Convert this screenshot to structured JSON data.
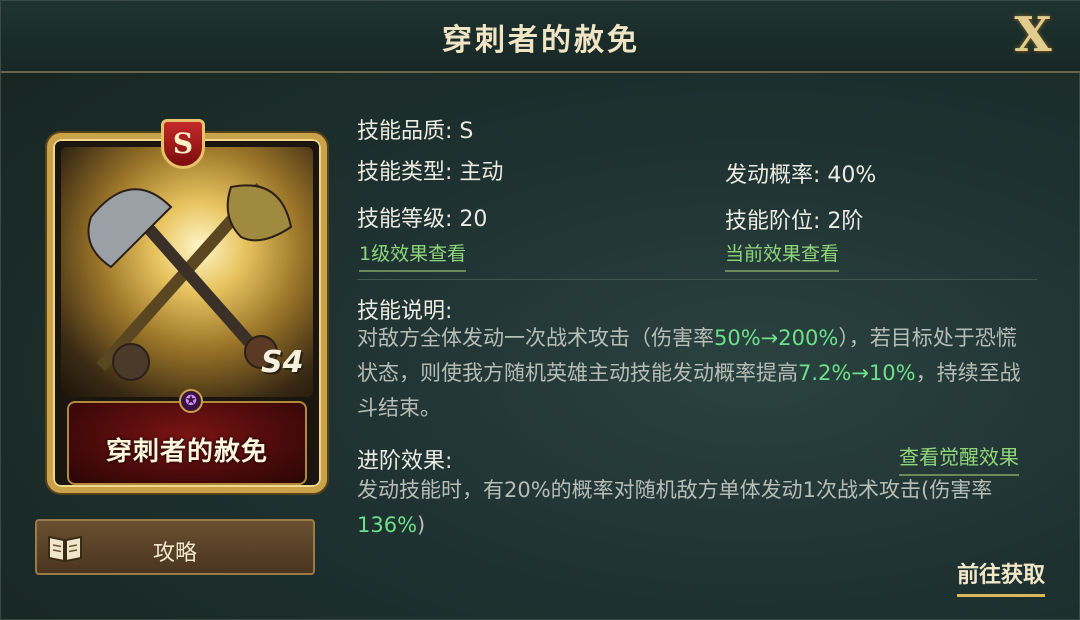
{
  "header": {
    "title": "穿刺者的赦免",
    "close_label": "X"
  },
  "card": {
    "grade_badge": "S",
    "name": "穿刺者的赦免",
    "level_mark": "S4",
    "emblem_icon": "faction-emblem-icon"
  },
  "guide_button": {
    "label": "攻略",
    "icon": "book-icon"
  },
  "stats": {
    "quality": "技能品质: S",
    "type": "技能类型: 主动",
    "chance": "发动概率: 40%",
    "level": "技能等级: 20",
    "rank": "技能阶位: 2阶"
  },
  "links": {
    "level1_effect": "1级效果查看",
    "current_effect": "当前效果查看",
    "awaken_effect": "查看觉醒效果"
  },
  "description": {
    "title": "技能说明:",
    "p1": "对敌方全体发动一次战术攻击（伤害率",
    "p1_hl": "50%→200%",
    "p2": "），若目标处于恐慌状态，则使我方随机英雄主动技能发动概率提高",
    "p2_hl": "7.2%→10%",
    "p3": "，持续至战斗结束。"
  },
  "advance": {
    "title": "进阶效果:",
    "p1": "发动技能时，有20%的概率对随机敌方单体发动1次战术攻击(伤害率",
    "p1_hl": "136%",
    "p2": ")"
  },
  "goto_button": {
    "label": "前往获取"
  },
  "colors": {
    "highlight": "#6ee08a",
    "gold": "#c9a24a",
    "link": "#8fd67a"
  }
}
